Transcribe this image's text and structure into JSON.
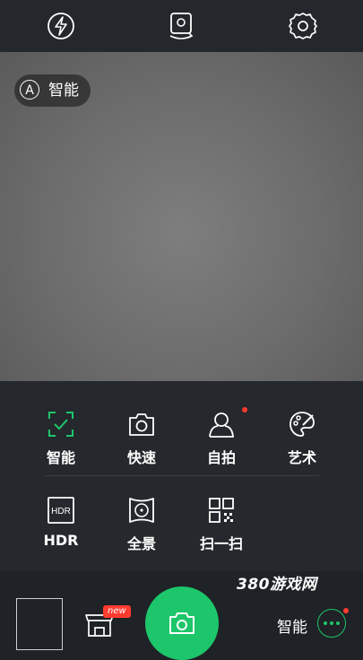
{
  "topbar": {
    "flash_icon": "flash-auto-icon",
    "switch_camera_icon": "switch-camera-icon",
    "settings_icon": "gear-icon"
  },
  "viewfinder": {
    "mode_chip": {
      "icon_letter": "A",
      "label": "智能"
    }
  },
  "modes": [
    {
      "label": "智能",
      "icon": "smart-check-icon",
      "active": true,
      "dot": false
    },
    {
      "label": "快速",
      "icon": "camera-icon",
      "active": false,
      "dot": false
    },
    {
      "label": "自拍",
      "icon": "person-icon",
      "active": false,
      "dot": true
    },
    {
      "label": "艺术",
      "icon": "palette-icon",
      "active": false,
      "dot": false
    },
    {
      "label": "HDR",
      "icon": "hdr-icon",
      "icon_text": "HDR",
      "active": false,
      "dot": false
    },
    {
      "label": "全景",
      "icon": "panorama-icon",
      "active": false,
      "dot": false
    },
    {
      "label": "扫一扫",
      "icon": "qr-scan-icon",
      "active": false,
      "dot": false
    }
  ],
  "bottombar": {
    "new_badge": "new",
    "watermark": "380游戏网",
    "mode_label": "智能",
    "more_icon": "more-dots-icon"
  },
  "colors": {
    "accent": "#1dc66a",
    "badge": "#ff3b30"
  }
}
